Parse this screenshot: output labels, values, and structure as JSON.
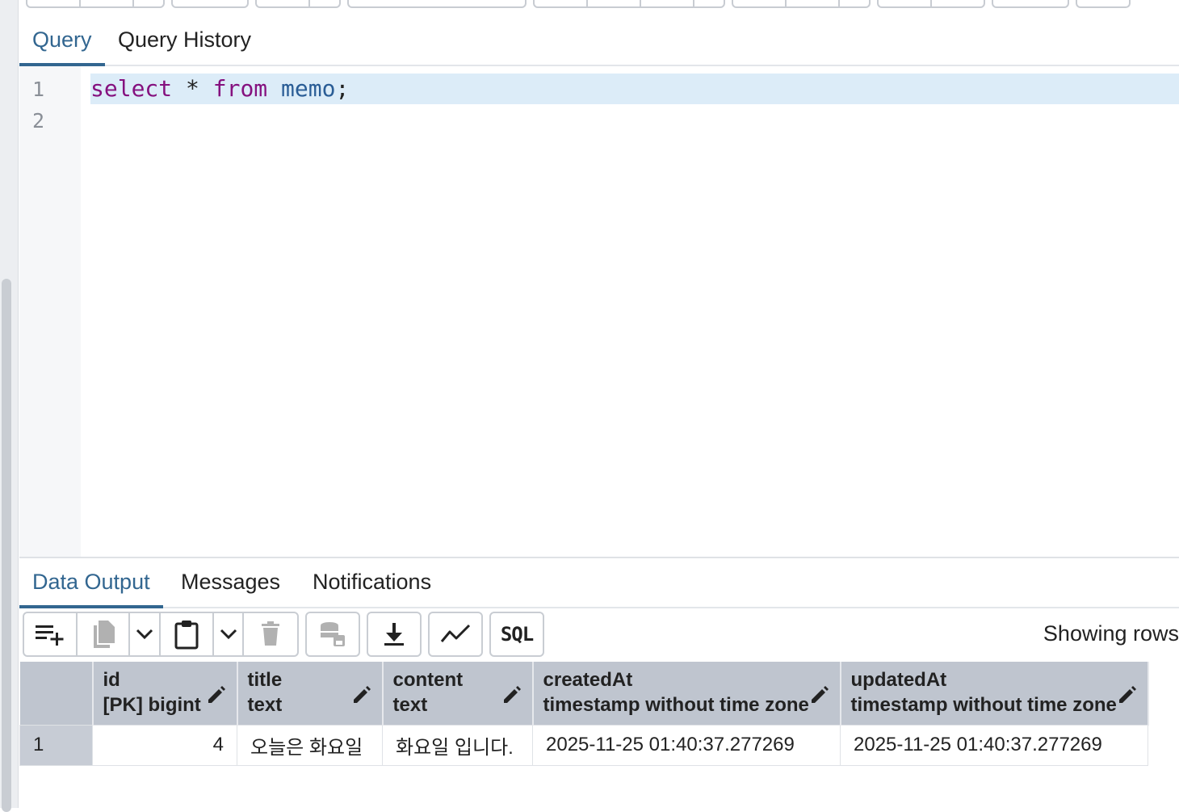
{
  "query_tabs": [
    "Query",
    "Query History"
  ],
  "editor": {
    "line_numbers": [
      "1",
      "2"
    ],
    "tokens": {
      "kw1": "select",
      "star": "*",
      "kw2": "from",
      "table": "memo",
      "semicolon": ";"
    }
  },
  "output_tabs": [
    "Data Output",
    "Messages",
    "Notifications"
  ],
  "toolbar_icons": [
    "add-row-icon",
    "copy-icon",
    "chevron-down-icon",
    "paste-icon",
    "chevron-down-icon",
    "delete-icon",
    "save-data-icon",
    "download-icon",
    "graph-icon",
    "sql-icon"
  ],
  "toolbar_sql_label": "SQL",
  "showing_rows": "Showing rows",
  "grid": {
    "columns": [
      {
        "name": "id",
        "type": "[PK] bigint"
      },
      {
        "name": "title",
        "type": "text"
      },
      {
        "name": "content",
        "type": "text"
      },
      {
        "name": "createdAt",
        "type": "timestamp without time zone"
      },
      {
        "name": "updatedAt",
        "type": "timestamp without time zone"
      }
    ],
    "rows": [
      {
        "row_no": "1",
        "id": "4",
        "title": "오늘은 화요일",
        "content": "화요일 입니다.",
        "createdAt": "2025-11-25 01:40:37.277269",
        "updatedAt": "2025-11-25 01:40:37.277269"
      }
    ]
  },
  "colors": {
    "accent": "#326690",
    "keyword": "#85117f",
    "identifier": "#2a5d96",
    "header_bg": "#bfc5cf",
    "line_highlight": "#dcecf8"
  }
}
